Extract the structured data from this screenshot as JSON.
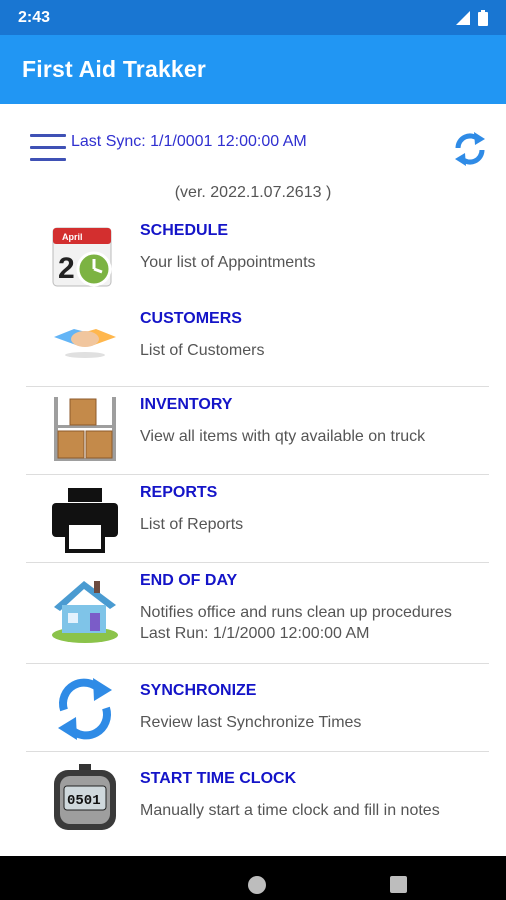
{
  "status_bar": {
    "time": "2:43"
  },
  "app_bar": {
    "title": "First Aid Trakker"
  },
  "sync": {
    "label": "Last Sync: 1/1/0001 12:00:00 AM"
  },
  "version": "(ver. 2022.1.07.2613 )",
  "menu": {
    "schedule": {
      "title": "SCHEDULE",
      "desc": "Your list of Appointments",
      "icon_text_month": "April",
      "icon_text_day": "2"
    },
    "customers": {
      "title": "CUSTOMERS",
      "desc": "List of Customers"
    },
    "inventory": {
      "title": "INVENTORY",
      "desc": "View all items with qty available on truck"
    },
    "reports": {
      "title": "REPORTS",
      "desc": "List of Reports"
    },
    "end_of_day": {
      "title": "END OF DAY",
      "desc": "Notifies office and runs clean up procedures",
      "last_run": "Last Run: 1/1/2000 12:00:00 AM"
    },
    "synchronize": {
      "title": "SYNCHRONIZE",
      "desc": "Review last Synchronize Times"
    },
    "time_clock": {
      "title": "START TIME CLOCK",
      "desc": "Manually start a time clock and fill in notes",
      "icon_text": "0501"
    }
  },
  "colors": {
    "status_bar": "#1976d2",
    "app_bar": "#2196f3",
    "item_title": "#1414c8",
    "item_desc": "#555555",
    "sync_text": "#3030d0"
  },
  "icons": [
    "signal-icon",
    "battery-icon",
    "menu-icon",
    "refresh-icon",
    "calendar-clock-icon",
    "handshake-icon",
    "boxes-shelf-icon",
    "printer-icon",
    "house-icon",
    "sync-arrows-icon",
    "stopwatch-icon",
    "home-nav-icon",
    "recents-nav-icon"
  ]
}
